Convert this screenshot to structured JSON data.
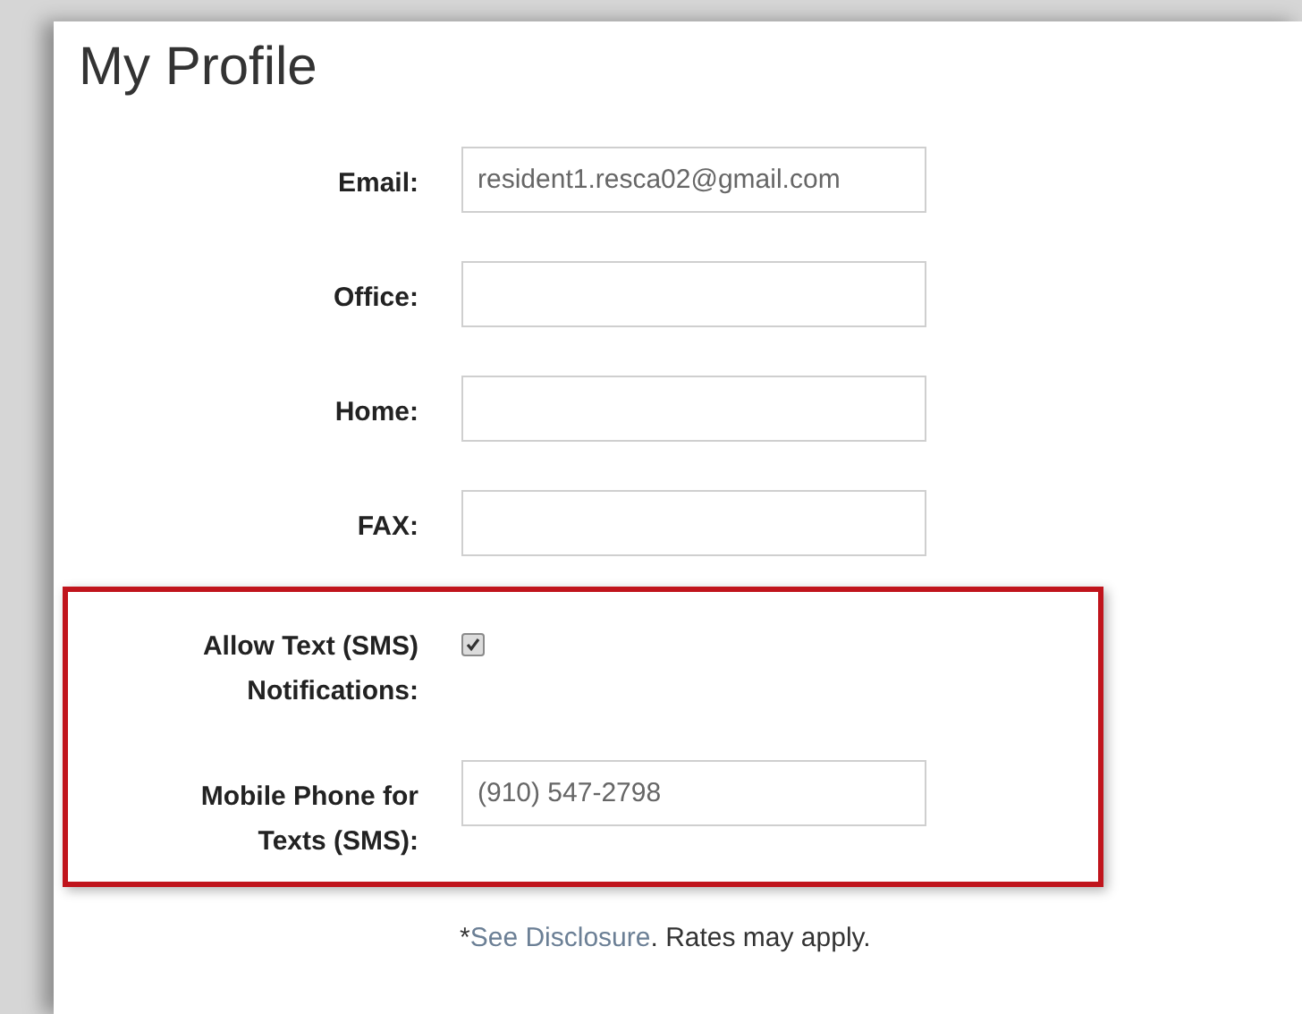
{
  "title": "My Profile",
  "fields": [
    {
      "kind": "text",
      "label": "Email:",
      "value": "resident1.resca02@gmail.com"
    },
    {
      "kind": "text",
      "label": "Office:"
    },
    {
      "kind": "text",
      "label": "Home:"
    },
    {
      "kind": "text",
      "label": "FAX:"
    }
  ],
  "highlighted_section": {
    "fields": [
      {
        "kind": "checkbox",
        "label": "Allow Text (SMS) Notifications:",
        "checked": true
      },
      {
        "kind": "text",
        "label": "Mobile Phone for Texts (SMS):",
        "value": "(910) 547-2798"
      }
    ]
  },
  "footnote": {
    "prefix": "*",
    "link": "See Disclosure",
    "suffix": ". Rates may apply."
  }
}
